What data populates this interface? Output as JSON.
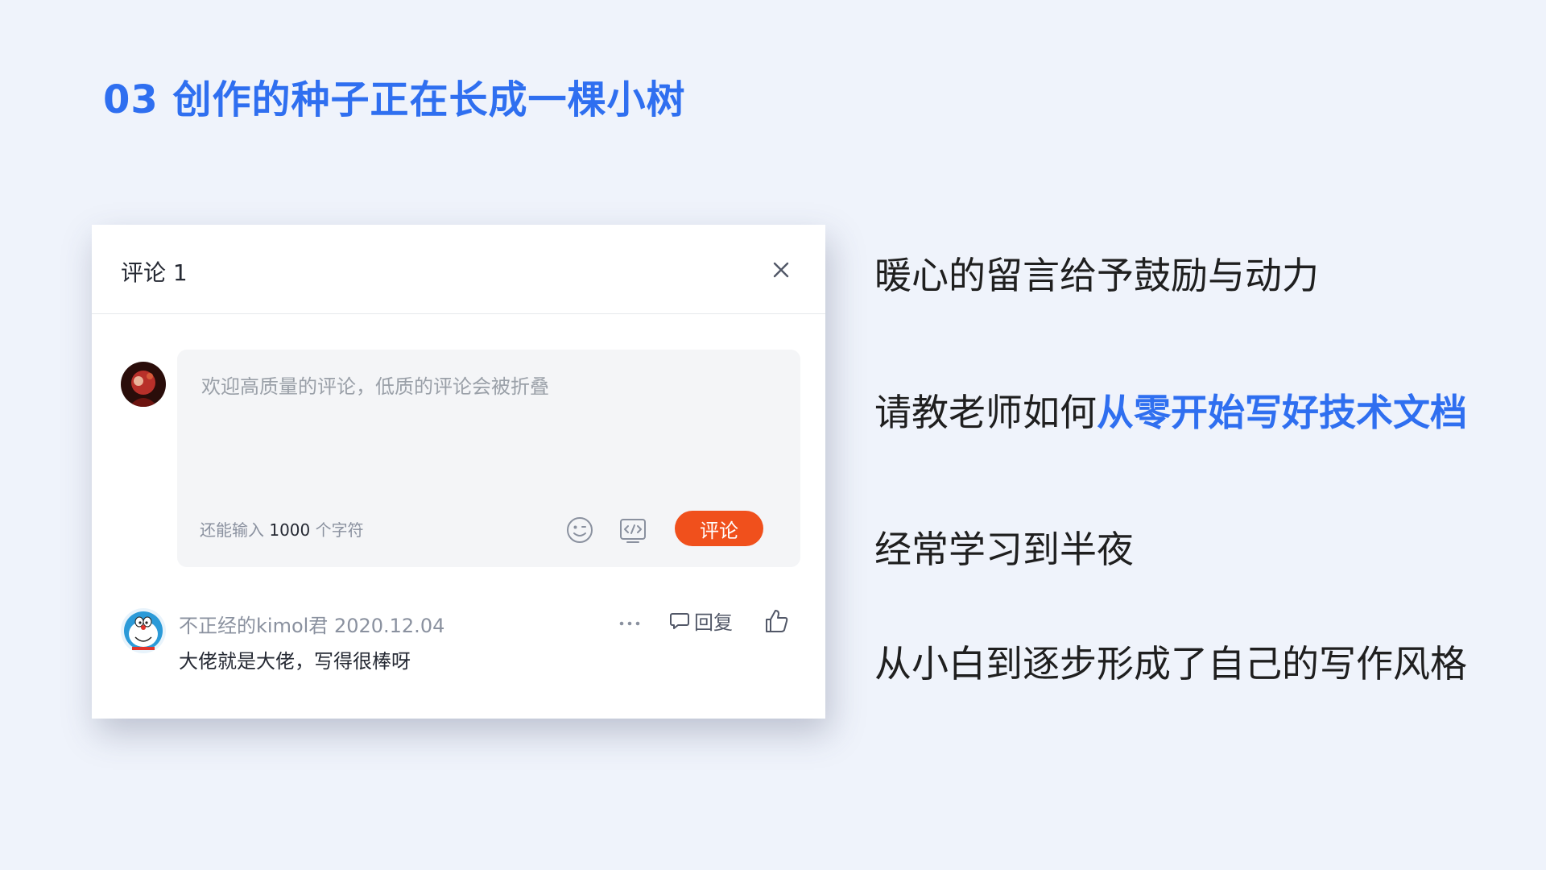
{
  "slide": {
    "title": "03 创作的种子正在长成一棵小树"
  },
  "panel": {
    "title": "评论 1",
    "input": {
      "placeholder": "欢迎高质量的评论，低质的评论会被折叠",
      "counter_prefix": "还能输入",
      "counter_value": "1000",
      "counter_suffix": "个字符",
      "submit_label": "评论"
    },
    "comment": {
      "author": "不正经的kimol君",
      "date": "2020.12.04",
      "text": "大佬就是大佬，写得很棒呀",
      "reply_label": "回复"
    },
    "icons": {
      "close": "close-icon",
      "emoji": "emoji-icon",
      "code": "code-icon",
      "more": "more-icon",
      "reply": "comment-bubble-icon",
      "like": "thumbs-up-icon"
    },
    "colors": {
      "submit": "#f0501c",
      "accent": "#2f6ff0"
    }
  },
  "points": {
    "p1": "暖心的留言给予鼓励与动力",
    "p2_plain": "请教老师如何",
    "p2_highlight": "从零开始写好技术文档",
    "p3": "经常学习到半夜",
    "p4": "从小白到逐步形成了自己的写作风格"
  }
}
